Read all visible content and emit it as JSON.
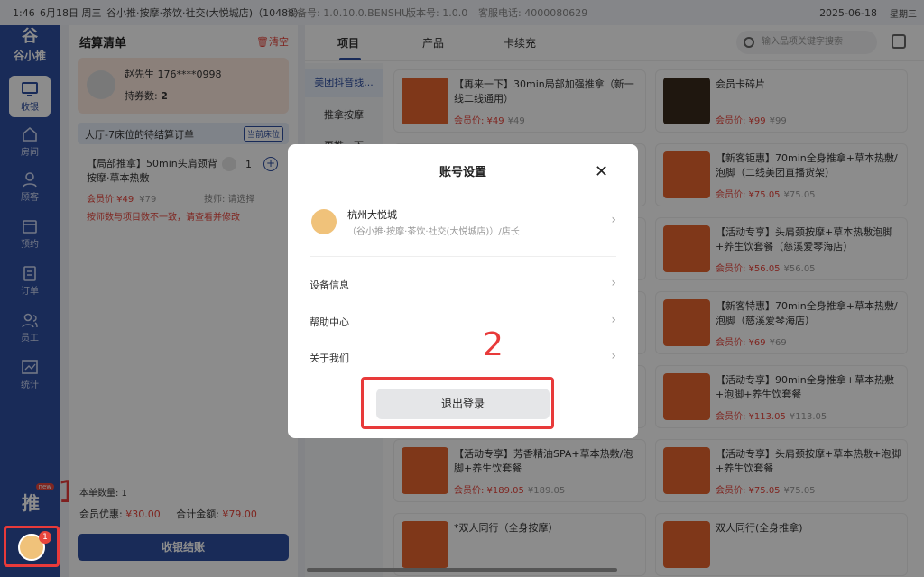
{
  "statusbar": {
    "time": "1:46",
    "date_short": "6月18日 周三",
    "store": "谷小推·按摩·茶饮·社交(大悦城店)（10488）",
    "device": "设备号: 1.0.10.0.BENSHU",
    "version": "版本号: 1.0.0",
    "phone": "客服电话: 4000080629",
    "date": "2025-06-18",
    "weekday": "星期三"
  },
  "sidebar": {
    "logo_top": "谷",
    "logo_text": "谷小推",
    "items": [
      {
        "label": "收银",
        "icon": "monitor-icon"
      },
      {
        "label": "房间",
        "icon": "house-icon"
      },
      {
        "label": "顾客",
        "icon": "user-icon"
      },
      {
        "label": "预约",
        "icon": "calendar-icon"
      },
      {
        "label": "订单",
        "icon": "clipboard-icon"
      },
      {
        "label": "员工",
        "icon": "staff-icon"
      },
      {
        "label": "统计",
        "icon": "chart-icon"
      }
    ],
    "promo": "推",
    "promo_badge": "new",
    "avatar_badge": "1",
    "annotation": "1"
  },
  "order": {
    "title": "结算清单",
    "clear": "清空",
    "customer_name": "赵先生 176****0998",
    "coupons_label": "持券数:",
    "coupons_value": "2",
    "bed_text": "大厅-7床位的待结算订单",
    "bed_button": "当前床位",
    "item_name": "【局部推拿】50min头肩颈背按摩·草本热敷",
    "item_qty": "1",
    "item_price": "会员价 ¥49",
    "item_orig": "¥79",
    "tech_label": "技师: 请选择",
    "warning": "按师数与项目数不一致，请查看并修改",
    "count_label": "本单数量: 1",
    "discount_label": "会员优惠:",
    "discount_value": "¥30.00",
    "total_label": "合计金额:",
    "total_value": "¥79.00",
    "checkout": "收银结账"
  },
  "catalog": {
    "tabs": [
      "项目",
      "产品",
      "卡续充"
    ],
    "search_placeholder": "输入品项关键字搜索",
    "categories": [
      "美团抖音线...",
      "推拿按摩",
      "再推一下"
    ],
    "cards": [
      {
        "title": "【再来一下】30min局部加强推拿（新一线二线通用）",
        "price": "会员价: ¥49",
        "orig": "¥49"
      },
      {
        "title": "会员卡碎片",
        "price": "会员价: ¥99",
        "orig": "¥99"
      },
      {
        "title": "【新客钜惠】70min全身推拿+草本热敷/泡脚（二线美团直播货架）",
        "price": "会员价: ¥75.05",
        "orig": "¥75.05"
      },
      {
        "title": "【活动专享】头肩颈按摩+草本热敷泡脚+养生饮套餐（慈溪爱琴海店）",
        "price": "会员价: ¥56.05",
        "orig": "¥56.05"
      },
      {
        "title": "【新客特惠】70min全身推拿+草本热敷/泡脚（慈溪爱琴海店）",
        "price": "会员价: ¥69",
        "orig": "¥69"
      },
      {
        "title": "【活动专享】90min全身推拿+草本热敷+泡脚+养生饮套餐",
        "price": "会员价: ¥113.05",
        "orig": "¥113.05"
      },
      {
        "title": "【活动专享】芳香精油SPA+草本热敷/泡脚+养生饮套餐",
        "price": "会员价: ¥189.05",
        "orig": "¥189.05"
      },
      {
        "title": "【活动专享】头肩颈按摩+草本热敷+泡脚+养生饮套餐",
        "price": "会员价: ¥75.05",
        "orig": "¥75.05"
      },
      {
        "title": "*双人同行（全身按摩）",
        "price": "",
        "orig": ""
      },
      {
        "title": "双人同行(全身推拿)",
        "price": "",
        "orig": ""
      }
    ]
  },
  "modal": {
    "title": "账号设置",
    "store_name": "杭州大悦城",
    "store_desc": "（谷小推·按摩·茶饮·社交(大悦城店)）/店长",
    "rows": [
      "设备信息",
      "帮助中心",
      "关于我们"
    ],
    "logout": "退出登录",
    "annotation": "2"
  },
  "colors": {
    "primary": "#2f4fa1",
    "danger": "#e8453c",
    "annotation": "#e83a3a"
  }
}
